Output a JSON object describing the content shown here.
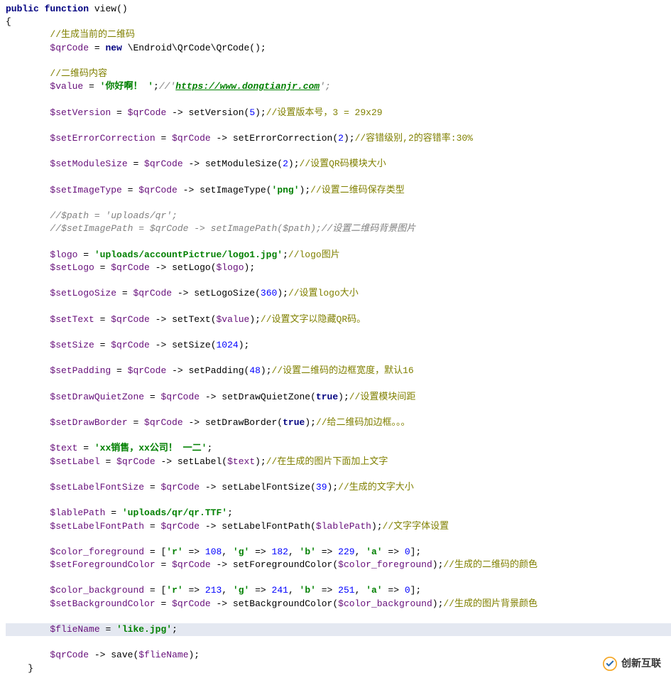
{
  "code": {
    "l1": {
      "kw1": "public",
      "kw2": "function",
      "name": "view",
      "p": "()"
    },
    "l2": "{",
    "l3": {
      "c": "//生成当前的二维码"
    },
    "l4": {
      "v": "$qrCode",
      "eq": " = ",
      "kw": "new",
      "cls": " \\Endroid\\QrCode\\QrCode();"
    },
    "l6": {
      "c": "//二维码内容"
    },
    "l7": {
      "v": "$value",
      "eq": " = ",
      "s1": "'你好啊！ '",
      "p": ";",
      "c1": "//'",
      "url": "https://www.dongtianjr.com",
      "c2": "';"
    },
    "l9": {
      "v1": "$setVersion",
      "eq1": " = ",
      "v2": "$qrCode",
      "arr": " -> ",
      "m": "setVersion",
      "p1": "(",
      "n": "5",
      "p2": ");",
      "c": "//设置版本号，3 = 29x29"
    },
    "l11": {
      "v1": "$setErrorCorrection",
      "eq1": " = ",
      "v2": "$qrCode",
      "arr": " -> ",
      "m": "setErrorCorrection",
      "p1": "(",
      "n": "2",
      "p2": ");",
      "c": "//容错级别,2的容错率:30%"
    },
    "l13": {
      "v1": "$setModuleSize",
      "eq1": " = ",
      "v2": "$qrCode",
      "arr": " -> ",
      "m": "setModuleSize",
      "p1": "(",
      "n": "2",
      "p2": ");",
      "c": "//设置QR码模块大小"
    },
    "l15": {
      "v1": "$setImageType",
      "eq1": " = ",
      "v2": "$qrCode",
      "arr": " -> ",
      "m": "setImageType",
      "p1": "(",
      "s": "'png'",
      "p2": ");",
      "c": "//设置二维码保存类型"
    },
    "l17": {
      "c": "//$path = 'uploads/qr';"
    },
    "l18": {
      "c": "//$setImagePath = $qrCode -> setImagePath($path);//设置二维码背景图片"
    },
    "l20": {
      "v": "$logo",
      "eq": " = ",
      "s": "'uploads/accountPictrue/logo1.jpg'",
      "p": ";",
      "c": "//logo图片"
    },
    "l21": {
      "v1": "$setLogo",
      "eq1": " = ",
      "v2": "$qrCode",
      "arr": " -> ",
      "m": "setLogo",
      "p1": "(",
      "v3": "$logo",
      "p2": ");"
    },
    "l23": {
      "v1": "$setLogoSize",
      "eq1": " = ",
      "v2": "$qrCode",
      "arr": " -> ",
      "m": "setLogoSize",
      "p1": "(",
      "n": "360",
      "p2": ");",
      "c": "//设置logo大小"
    },
    "l25": {
      "v1": "$setText",
      "eq1": " = ",
      "v2": "$qrCode",
      "arr": " -> ",
      "m": "setText",
      "p1": "(",
      "v3": "$value",
      "p2": ");",
      "c": "//设置文字以隐藏QR码。"
    },
    "l27": {
      "v1": "$setSize",
      "eq1": " = ",
      "v2": "$qrCode",
      "arr": " -> ",
      "m": "setSize",
      "p1": "(",
      "n": "1024",
      "p2": ");"
    },
    "l29": {
      "v1": "$setPadding",
      "eq1": " = ",
      "v2": "$qrCode",
      "arr": " -> ",
      "m": "setPadding",
      "p1": "(",
      "n": "48",
      "p2": ");",
      "c": "//设置二维码的边框宽度，默认16"
    },
    "l31": {
      "v1": "$setDrawQuietZone",
      "eq1": " = ",
      "v2": "$qrCode",
      "arr": " -> ",
      "m": "setDrawQuietZone",
      "p1": "(",
      "k": "true",
      "p2": ");",
      "c": "//设置模块间距"
    },
    "l33": {
      "v1": "$setDrawBorder",
      "eq1": " = ",
      "v2": "$qrCode",
      "arr": " -> ",
      "m": "setDrawBorder",
      "p1": "(",
      "k": "true",
      "p2": ");",
      "c": "//给二维码加边框。。。"
    },
    "l35": {
      "v": "$text",
      "eq": " = ",
      "s": "'xx销售，xx公司！ 一二'",
      "p": ";"
    },
    "l36": {
      "v1": "$setLabel",
      "eq1": " = ",
      "v2": "$qrCode",
      "arr": " -> ",
      "m": "setLabel",
      "p1": "(",
      "v3": "$text",
      "p2": ");",
      "c": "//在生成的图片下面加上文字"
    },
    "l38": {
      "v1": "$setLabelFontSize",
      "eq1": " = ",
      "v2": "$qrCode",
      "arr": " -> ",
      "m": "setLabelFontSize",
      "p1": "(",
      "n": "39",
      "p2": ");",
      "c": "//生成的文字大小"
    },
    "l40": {
      "v": "$lablePath",
      "eq": " = ",
      "s": "'uploads/qr/qr.TTF'",
      "p": ";"
    },
    "l41": {
      "v1": "$setLabelFontPath",
      "eq1": " = ",
      "v2": "$qrCode",
      "arr": " -> ",
      "m": "setLabelFontPath",
      "p1": "(",
      "v3": "$lablePath",
      "p2": ");",
      "c": "//文字字体设置"
    },
    "l43": {
      "v": "$color_foreground",
      "eq": " = [",
      "k1": "'r'",
      "a1": " => ",
      "n1": "108",
      "c1": ", ",
      "k2": "'g'",
      "a2": " => ",
      "n2": "182",
      "c2": ", ",
      "k3": "'b'",
      "a3": " => ",
      "n3": "229",
      "c3": ", ",
      "k4": "'a'",
      "a4": " => ",
      "n4": "0",
      "p": "];"
    },
    "l44": {
      "v1": "$setForegroundColor",
      "eq1": " = ",
      "v2": "$qrCode",
      "arr": " -> ",
      "m": "setForegroundColor",
      "p1": "(",
      "v3": "$color_foreground",
      "p2": ");",
      "c": "//生成的二维码的颜色"
    },
    "l46": {
      "v": "$color_background",
      "eq": " = [",
      "k1": "'r'",
      "a1": " => ",
      "n1": "213",
      "c1": ", ",
      "k2": "'g'",
      "a2": " => ",
      "n2": "241",
      "c2": ", ",
      "k3": "'b'",
      "a3": " => ",
      "n3": "251",
      "c3": ", ",
      "k4": "'a'",
      "a4": " => ",
      "n4": "0",
      "p": "];"
    },
    "l47": {
      "v1": "$setBackgroundColor",
      "eq1": " = ",
      "v2": "$qrCode",
      "arr": " -> ",
      "m": "setBackgroundColor",
      "p1": "(",
      "v3": "$color_background",
      "p2": ");",
      "c": "//生成的图片背景颜色"
    },
    "l49": {
      "v": "$flieName",
      "eq": " = ",
      "s": "'like.jpg'",
      "p": ";"
    },
    "l51": {
      "v1": "$qrCode",
      "arr": " -> ",
      "m": "save",
      "p1": "(",
      "v2": "$flieName",
      "p2": ");"
    },
    "l52": "}"
  },
  "watermark": "创新互联",
  "indent1": "    ",
  "indent2": "        "
}
